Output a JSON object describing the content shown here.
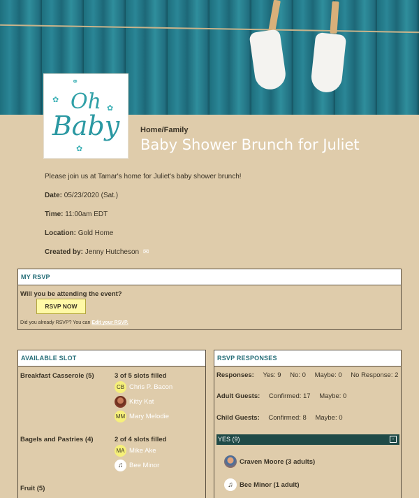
{
  "event": {
    "logo_line1": "Oh",
    "logo_line2": "Baby",
    "category": "Home/Family",
    "title": "Baby Shower Brunch for Juliet",
    "description": "Please join us at Tamar's home for Juliet's baby shower brunch!",
    "date_label": "Date:",
    "date_value": "05/23/2020 (Sat.)",
    "time_label": "Time:",
    "time_value": "11:00am EDT",
    "location_label": "Location:",
    "location_value": "Gold Home",
    "created_label": "Created by:",
    "created_value": "Jenny Hutcheson"
  },
  "my_rsvp": {
    "header": "MY RSVP",
    "question": "Will you be attending the event?",
    "button": "RSVP NOW",
    "already_text": "Did you already RSVP? You can",
    "edit_link": "Edit your RSVP."
  },
  "slots": {
    "header": "AVAILABLE SLOT",
    "items": [
      {
        "name": "Breakfast Casserole (5)",
        "filled": "3 of 5 slots filled",
        "people": [
          {
            "initials": "CB",
            "name": "Chris P. Bacon",
            "avatar": "initials"
          },
          {
            "initials": "",
            "name": "Kitty Kat",
            "avatar": "photo"
          },
          {
            "initials": "MM",
            "name": "Mary Melodie",
            "avatar": "initials"
          }
        ]
      },
      {
        "name": "Bagels and Pastries (4)",
        "filled": "2 of 4 slots filled",
        "people": [
          {
            "initials": "MA",
            "name": "Mike Ake",
            "avatar": "initials"
          },
          {
            "initials": "",
            "name": "Bee Minor",
            "avatar": "music-note-icon"
          }
        ]
      },
      {
        "name": "Fruit (5)"
      }
    ]
  },
  "responses": {
    "header": "RSVP RESPONSES",
    "responses_label": "Responses:",
    "yes": "Yes: 9",
    "no": "No: 0",
    "maybe": "Maybe: 0",
    "no_response": "No Response: 2",
    "adult_label": "Adult Guests:",
    "adult_confirmed": "Confirmed: 17",
    "adult_maybe": "Maybe: 0",
    "child_label": "Child Guests:",
    "child_confirmed": "Confirmed: 8",
    "child_maybe": "Maybe: 0",
    "yes_bar": "YES (9)",
    "collapse_icon": "-",
    "guests": [
      {
        "name": "Craven Moore (3 adults)",
        "avatar": "photo"
      },
      {
        "name": "Bee Minor (1 adult)",
        "avatar": "music-note-icon"
      }
    ]
  },
  "colors": {
    "background": "#dfccab",
    "accent_teal": "#276f79",
    "yes_bar": "#1f4a47",
    "button_yellow": "#fff9a6"
  }
}
